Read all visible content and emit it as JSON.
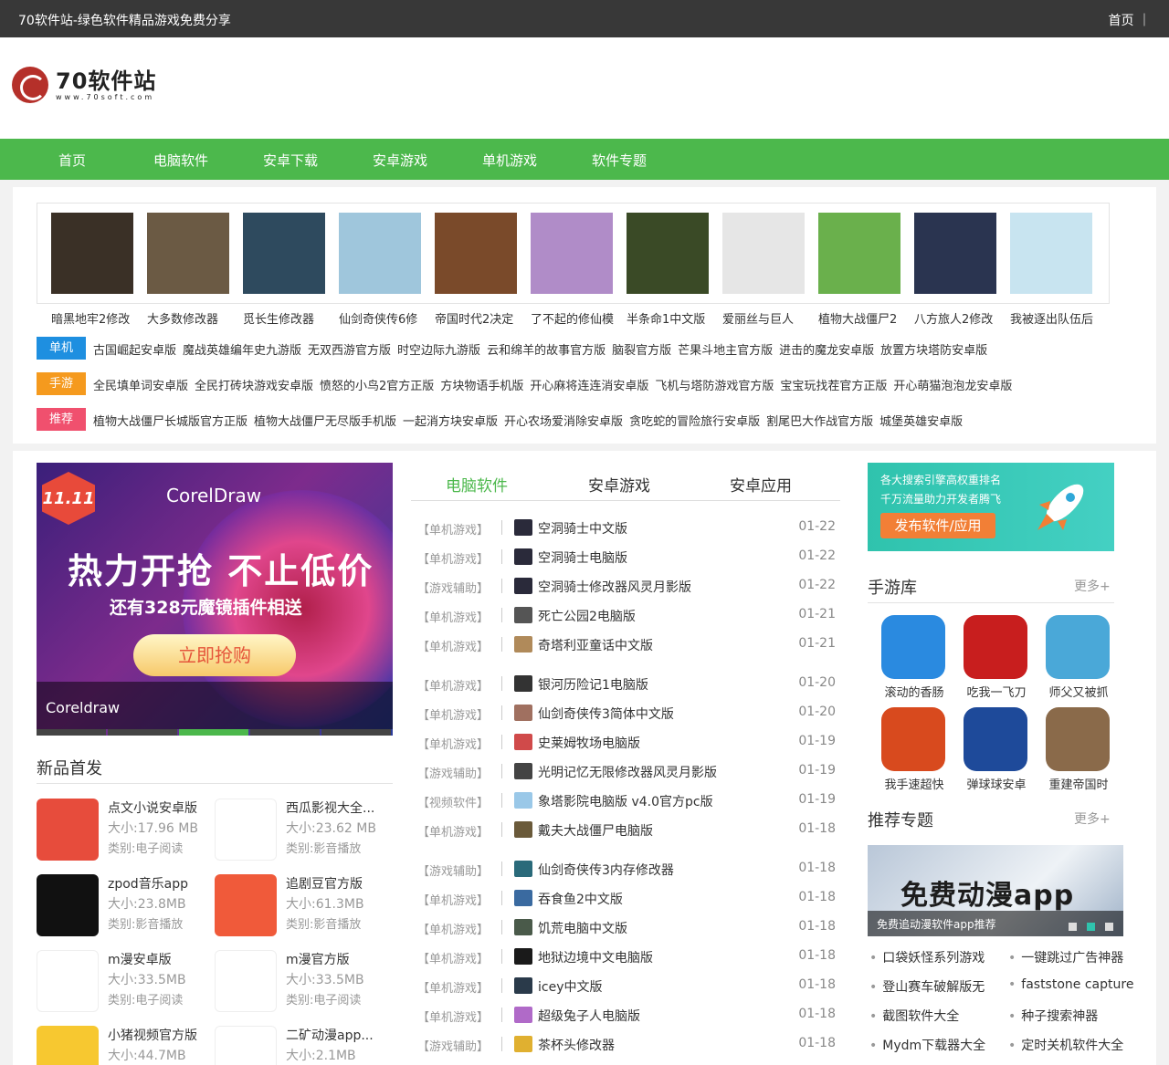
{
  "topbar": {
    "site_title": "70软件站-绿色软件精品游戏免费分享",
    "home_link": "首页 ｜"
  },
  "logo": {
    "name": "70软件站",
    "url": "www.70soft.com"
  },
  "nav": [
    "首页",
    "电脑软件",
    "安卓下载",
    "安卓游戏",
    "单机游戏",
    "软件专题"
  ],
  "games": [
    {
      "name": "暗黑地牢2修改",
      "color": "#3a3026"
    },
    {
      "name": "大多数修改器",
      "color": "#6b5a44"
    },
    {
      "name": "觅长生修改器",
      "color": "#2e4a5e"
    },
    {
      "name": "仙剑奇侠传6修",
      "color": "#9fc6dc"
    },
    {
      "name": "帝国时代2决定",
      "color": "#7a4a2a"
    },
    {
      "name": "了不起的修仙模",
      "color": "#b08cc8"
    },
    {
      "name": "半条命1中文版",
      "color": "#3a4a26"
    },
    {
      "name": "爱丽丝与巨人",
      "color": "#e6e6e6"
    },
    {
      "name": "植物大战僵尸2",
      "color": "#6ab04c"
    },
    {
      "name": "八方旅人2修改",
      "color": "#2a3450"
    },
    {
      "name": "我被逐出队伍后",
      "color": "#c8e4f0"
    }
  ],
  "tags": [
    {
      "label": "单机",
      "color": "#1e8fe0",
      "links": [
        "古国崛起安卓版",
        "魔战英雄编年史九游版",
        "无双西游官方版",
        "时空边际九游版",
        "云和绵羊的故事官方版",
        "脑裂官方版",
        "芒果斗地主官方版",
        "进击的魔龙安卓版",
        "放置方块塔防安卓版"
      ]
    },
    {
      "label": "手游",
      "color": "#f59a1e",
      "links": [
        "全民填单词安卓版",
        "全民打砖块游戏安卓版",
        "愤怒的小鸟2官方正版",
        "方块物语手机版",
        "开心麻将连连消安卓版",
        "飞机与塔防游戏官方版",
        "宝宝玩找茬官方正版",
        "开心萌猫泡泡龙安卓版"
      ]
    },
    {
      "label": "推荐",
      "color": "#f0506e",
      "links": [
        "植物大战僵尸长城版官方正版",
        "植物大战僵尸无尽版手机版",
        "一起消方块安卓版",
        "开心农场爱消除安卓版",
        "贪吃蛇的冒险旅行安卓版",
        "割尾巴大作战官方版",
        "城堡英雄安卓版"
      ]
    }
  ],
  "banner": {
    "badge": "11.11",
    "brand": "CorelDraw",
    "headline": "热力开抢 不止低价",
    "sub": "还有328元魔镜插件相送",
    "button": "立即抢购",
    "caption": "Coreldraw"
  },
  "new_apps": {
    "title": "新品首发",
    "items": [
      {
        "title": "点文小说安卓版",
        "size": "大小:17.96 MB",
        "cat": "类别:电子阅读",
        "color": "#e74c3c"
      },
      {
        "title": "西瓜影视大全...",
        "size": "大小:23.62 MB",
        "cat": "类别:影音播放",
        "color": "#ffffff"
      },
      {
        "title": "zpod音乐app",
        "size": "大小:23.8MB",
        "cat": "类别:影音播放",
        "color": "#111111"
      },
      {
        "title": "追剧豆官方版",
        "size": "大小:61.3MB",
        "cat": "类别:影音播放",
        "color": "#f05a3a"
      },
      {
        "title": "m漫安卓版",
        "size": "大小:33.5MB",
        "cat": "类别:电子阅读",
        "color": "#ffffff"
      },
      {
        "title": "m漫官方版",
        "size": "大小:33.5MB",
        "cat": "类别:电子阅读",
        "color": "#ffffff"
      },
      {
        "title": "小猪视频官方版",
        "size": "大小:44.7MB",
        "cat": "",
        "color": "#f7c830"
      },
      {
        "title": "二矿动漫app...",
        "size": "大小:2.1MB",
        "cat": "",
        "color": "#ffffff"
      }
    ]
  },
  "tabs": [
    "电脑软件",
    "安卓游戏",
    "安卓应用"
  ],
  "list": [
    {
      "cat": "【单机游戏】",
      "title": "空洞骑士中文版",
      "date": "01-22",
      "color": "#2a2a3a"
    },
    {
      "cat": "【单机游戏】",
      "title": "空洞骑士电脑版",
      "date": "01-22",
      "color": "#2a2a3a"
    },
    {
      "cat": "【游戏辅助】",
      "title": "空洞骑士修改器风灵月影版",
      "date": "01-22",
      "color": "#2a2a3a"
    },
    {
      "cat": "【单机游戏】",
      "title": "死亡公园2电脑版",
      "date": "01-21",
      "color": "#555555"
    },
    {
      "cat": "【单机游戏】",
      "title": "奇塔利亚童话中文版",
      "date": "01-21",
      "color": "#b08a5a"
    },
    {
      "cat": "【单机游戏】",
      "title": "银河历险记1电脑版",
      "date": "01-20",
      "color": "#333333"
    },
    {
      "cat": "【单机游戏】",
      "title": "仙剑奇侠传3简体中文版",
      "date": "01-20",
      "color": "#a07060"
    },
    {
      "cat": "【单机游戏】",
      "title": "史莱姆牧场电脑版",
      "date": "01-19",
      "color": "#d04a4a"
    },
    {
      "cat": "【游戏辅助】",
      "title": "光明记忆无限修改器风灵月影版",
      "date": "01-19",
      "color": "#444444"
    },
    {
      "cat": "【视频软件】",
      "title": "象塔影院电脑版 v4.0官方pc版",
      "date": "01-19",
      "color": "#9ac8e8"
    },
    {
      "cat": "【单机游戏】",
      "title": "戴夫大战僵尸电脑版",
      "date": "01-18",
      "color": "#6a5a3a"
    },
    {
      "cat": "【游戏辅助】",
      "title": "仙剑奇侠传3内存修改器",
      "date": "01-18",
      "color": "#2a6a7a"
    },
    {
      "cat": "【单机游戏】",
      "title": "吞食鱼2中文版",
      "date": "01-18",
      "color": "#3a6aa0"
    },
    {
      "cat": "【单机游戏】",
      "title": "饥荒电脑中文版",
      "date": "01-18",
      "color": "#4a5a4a"
    },
    {
      "cat": "【单机游戏】",
      "title": "地狱边境中文电脑版",
      "date": "01-18",
      "color": "#1a1a1a"
    },
    {
      "cat": "【单机游戏】",
      "title": "icey中文版",
      "date": "01-18",
      "color": "#2a3a4a"
    },
    {
      "cat": "【单机游戏】",
      "title": "超级兔子人电脑版",
      "date": "01-18",
      "color": "#b06ac8"
    },
    {
      "cat": "【游戏辅助】",
      "title": "茶杯头修改器",
      "date": "01-18",
      "color": "#e0b030"
    }
  ],
  "ad": {
    "line1": "各大搜索引擎高权重排名",
    "line2": "千万流量助力开发者腾飞",
    "button": "发布软件/应用"
  },
  "mobile_games": {
    "title": "手游库",
    "more": "更多+",
    "items": [
      {
        "name": "滚动的香肠",
        "color": "#2a8ae0"
      },
      {
        "name": "吃我一飞刀",
        "color": "#c81e1e"
      },
      {
        "name": "师父又被抓",
        "color": "#4aa8d8"
      },
      {
        "name": "我手速超快",
        "color": "#d84a1e"
      },
      {
        "name": "弹球球安卓",
        "color": "#1e4a9a"
      },
      {
        "name": "重建帝国时",
        "color": "#8a6a4a"
      }
    ]
  },
  "topics": {
    "title": "推荐专题",
    "more": "更多+",
    "banner_big": "免费动漫app",
    "banner_caption": "免费追动漫软件app推荐",
    "links": [
      "口袋妖怪系列游戏",
      "一键跳过广告神器",
      "登山赛车破解版无",
      "faststone capture",
      "截图软件大全",
      "种子搜索神器",
      "Mydm下载器大全",
      "定时关机软件大全"
    ]
  },
  "colors": {
    "green": "#4cb84c",
    "topbar": "#383838"
  }
}
